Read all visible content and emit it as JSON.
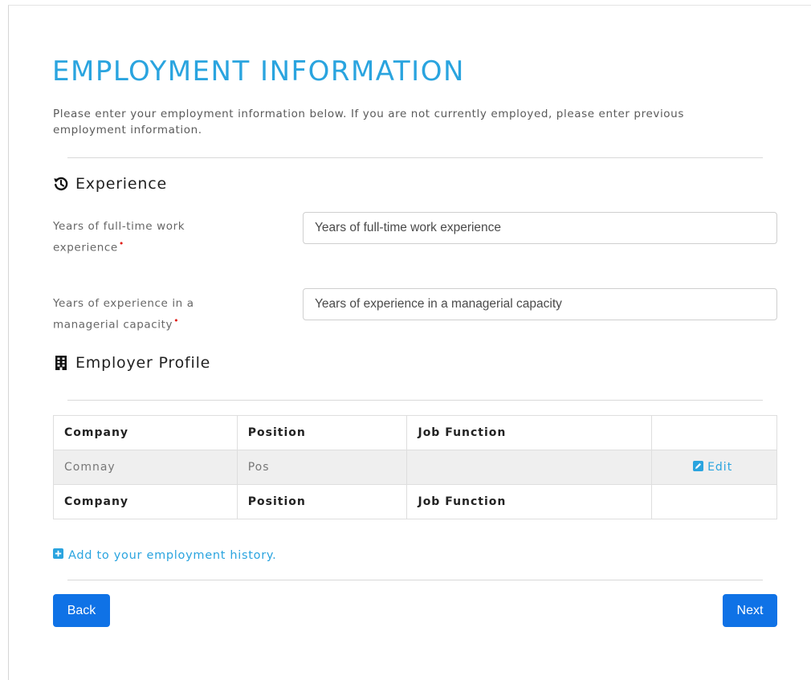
{
  "page": {
    "title": "EMPLOYMENT INFORMATION",
    "intro": "Please enter your employment information below. If you are not currently employed, please enter previous employment information."
  },
  "experience": {
    "heading": "Experience",
    "icon": "history-icon",
    "fields": [
      {
        "label": "Years of full-time work experience",
        "required": true,
        "placeholder": "Years of full-time work experience",
        "value": ""
      },
      {
        "label": "Years of experience in a managerial capacity",
        "required": true,
        "placeholder": "Years of experience in a managerial capacity",
        "value": ""
      }
    ]
  },
  "employer_profile": {
    "heading": "Employer Profile",
    "icon": "building-icon",
    "columns": [
      "Company",
      "Position",
      "Job Function",
      ""
    ],
    "rows": [
      {
        "company": "Comnay",
        "position": "Pos",
        "job_function": "",
        "action": "Edit",
        "action_icon": "edit-icon"
      }
    ],
    "footer": [
      "Company",
      "Position",
      "Job Function",
      ""
    ]
  },
  "add_history": {
    "label": "Add to your employment history.",
    "icon": "plus-square-icon"
  },
  "nav": {
    "back_label": "Back",
    "next_label": "Next"
  },
  "colors": {
    "accent": "#2aa4df",
    "button": "#0f72e6",
    "required": "#e0201a",
    "row_highlight": "#efefef"
  }
}
